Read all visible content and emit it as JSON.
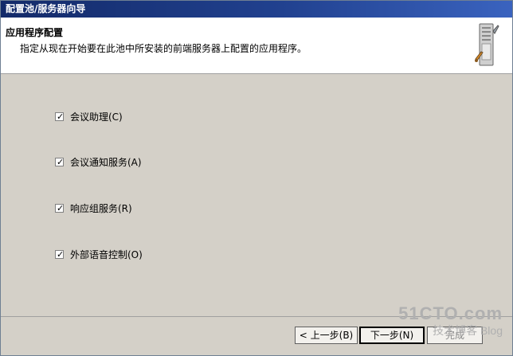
{
  "window": {
    "title": "配置池/服务器向导"
  },
  "header": {
    "title": "应用程序配置",
    "description": "指定从现在开始要在此池中所安装的前端服务器上配置的应用程序。"
  },
  "options": [
    {
      "label": "会议助理(C)",
      "checked": true
    },
    {
      "label": "会议通知服务(A)",
      "checked": true
    },
    {
      "label": "响应组服务(R)",
      "checked": true
    },
    {
      "label": "外部语音控制(O)",
      "checked": true
    }
  ],
  "buttons": {
    "back": "< 上一步(B)",
    "next": "下一步(N)",
    "finish": "完成"
  },
  "watermark": {
    "main": "51CTO.com",
    "sub": "技术博客",
    "blog": "Blog"
  }
}
